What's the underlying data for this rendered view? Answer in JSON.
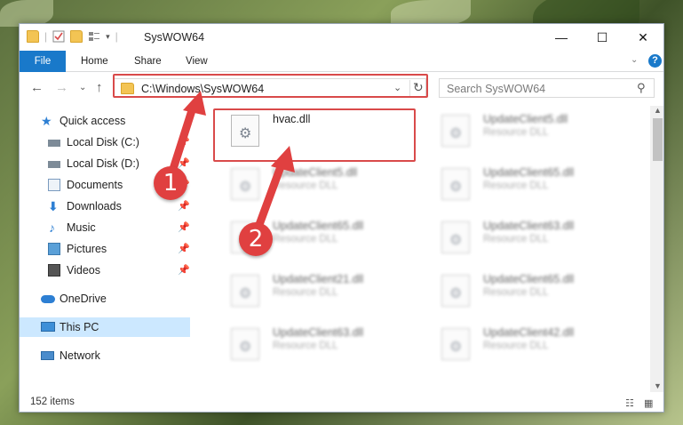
{
  "window": {
    "title": "SysWOW64"
  },
  "ribbon": {
    "tabs": [
      "File",
      "Home",
      "Share",
      "View"
    ]
  },
  "address": {
    "path": "C:\\Windows\\SysWOW64"
  },
  "search": {
    "placeholder": "Search SysWOW64"
  },
  "sidebar": {
    "items": [
      {
        "label": "Quick access",
        "icon": "star-icon",
        "pinned": false
      },
      {
        "label": "Local Disk (C:)",
        "icon": "drive-icon",
        "pinned": true
      },
      {
        "label": "Local Disk (D:)",
        "icon": "drive-icon",
        "pinned": true
      },
      {
        "label": "Documents",
        "icon": "documents-icon",
        "pinned": true
      },
      {
        "label": "Downloads",
        "icon": "download-icon",
        "pinned": true
      },
      {
        "label": "Music",
        "icon": "music-icon",
        "pinned": true
      },
      {
        "label": "Pictures",
        "icon": "pictures-icon",
        "pinned": true
      },
      {
        "label": "Videos",
        "icon": "videos-icon",
        "pinned": true
      },
      {
        "label": "OneDrive",
        "icon": "cloud-icon",
        "pinned": false
      },
      {
        "label": "This PC",
        "icon": "computer-icon",
        "pinned": false,
        "selected": true
      },
      {
        "label": "Network",
        "icon": "network-icon",
        "pinned": false
      }
    ]
  },
  "files": [
    {
      "name": "hvac.dll",
      "type": ""
    },
    {
      "name": "UpdateClient5.dll",
      "type": "Resource DLL"
    },
    {
      "name": "UpdateClient5.dll",
      "type": "Resource DLL"
    },
    {
      "name": "UpdateClient65.dll",
      "type": "Resource DLL"
    },
    {
      "name": "UpdateClient65.dll",
      "type": "Resource DLL"
    },
    {
      "name": "UpdateClient63.dll",
      "type": "Resource DLL"
    },
    {
      "name": "UpdateClient21.dll",
      "type": "Resource DLL"
    },
    {
      "name": "UpdateClient65.dll",
      "type": "Resource DLL"
    },
    {
      "name": "UpdateClient63.dll",
      "type": "Resource DLL"
    },
    {
      "name": "UpdateClient42.dll",
      "type": "Resource DLL"
    }
  ],
  "status": {
    "item_count": "152 items"
  },
  "annotations": {
    "badge1": "1",
    "badge2": "2"
  },
  "colors": {
    "accent": "#1979ca",
    "highlight": "#d94a4a"
  }
}
